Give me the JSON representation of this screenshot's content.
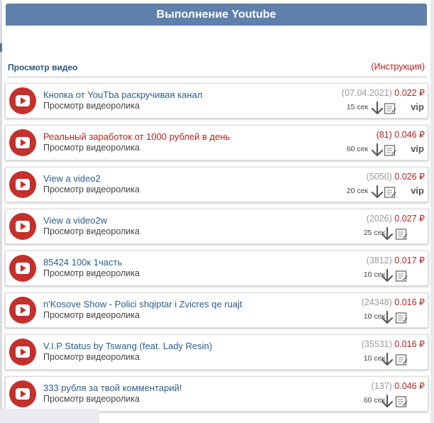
{
  "header": {
    "title": "Выполнение Youtube"
  },
  "section": {
    "title": "Просмотр видео",
    "instruction": "(Инструкция)"
  },
  "tasks": [
    {
      "title": "Кнопка от YouTba раскручивая канал",
      "subtitle": "Просмотр видеоролика",
      "count": "(07.04.2021)",
      "price": "0.022 ₽",
      "time": "15 сек",
      "vip": "vip",
      "title_red": false,
      "count_red": false,
      "has_vip": true
    },
    {
      "title": "Реальный заработок от 1000 рублей в день",
      "subtitle": "Просмотр видеоролика",
      "count": "(81)",
      "price": "0.046 ₽",
      "time": "60 сек",
      "vip": "vip",
      "title_red": true,
      "count_red": true,
      "has_vip": true
    },
    {
      "title": "View a video2",
      "subtitle": "Просмотр видеоролика",
      "count": "(5050)",
      "price": "0.026 ₽",
      "time": "20 сек",
      "vip": "vip",
      "title_red": false,
      "count_red": false,
      "has_vip": true
    },
    {
      "title": "View a video2w",
      "subtitle": "Просмотр видеоролика",
      "count": "(2026)",
      "price": "0.027 ₽",
      "time": "25 сек",
      "vip": "",
      "title_red": false,
      "count_red": false,
      "has_vip": false
    },
    {
      "title": "85424 100к 1часть",
      "subtitle": "Просмотр видеоролика",
      "count": "(3812)",
      "price": "0.017 ₽",
      "time": "10 сек",
      "vip": "",
      "title_red": false,
      "count_red": false,
      "has_vip": false
    },
    {
      "title": "n'Kosove Show - Polici shqiptar i Zvicres qe ruajt",
      "subtitle": "Просмотр видеоролика",
      "count": "(24348)",
      "price": "0.016 ₽",
      "time": "10 сек",
      "vip": "",
      "title_red": false,
      "count_red": false,
      "has_vip": false
    },
    {
      "title": "V.I.P Status by Tswang (feat. Lady Resin)",
      "subtitle": "Просмотр видеоролика",
      "count": "(35531)",
      "price": "0.016 ₽",
      "time": "10 сек",
      "vip": "",
      "title_red": false,
      "count_red": false,
      "has_vip": false
    },
    {
      "title": "333 рубля за твой комментарий!",
      "subtitle": "Просмотр видеоролика",
      "count": "(137)",
      "price": "0.046 ₽",
      "time": "60 сек",
      "vip": "",
      "title_red": false,
      "count_red": false,
      "has_vip": false
    }
  ],
  "icons": {
    "task_icon": "youtube-icon",
    "download": "download-arrow-icon",
    "report": "report-form-icon"
  },
  "colors": {
    "header_bg": "#5e80ab",
    "accent_red": "#b22222",
    "link_blue": "#2a5d8f",
    "youtube_red": "#c4302b"
  }
}
